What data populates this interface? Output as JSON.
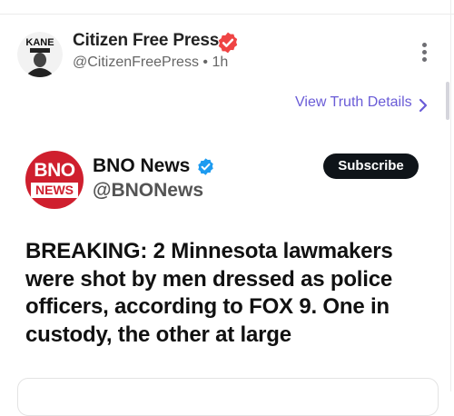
{
  "post": {
    "author_name": "Citizen Free Press",
    "handle": "@CitizenFreePress",
    "separator": "•",
    "time": "1h",
    "avatar_text": "KANE",
    "view_details_label": "View Truth Details"
  },
  "embed": {
    "logo_top": "BNO",
    "logo_bottom": "NEWS",
    "name": "BNO News",
    "handle": "@BNONews",
    "subscribe_label": "Subscribe",
    "text": "BREAKING: 2 Minnesota lawmakers were shot by men dressed as police officers, according to FOX 9. One in custody, the other at large"
  },
  "colors": {
    "verified_main": "#ef4444",
    "verified_embed": "#1d9bf0",
    "link": "#6a5cd7",
    "logo_red": "#cf1f2e"
  },
  "icons": [
    "verified-badge-icon",
    "more-options-icon",
    "chevron-right-icon"
  ]
}
